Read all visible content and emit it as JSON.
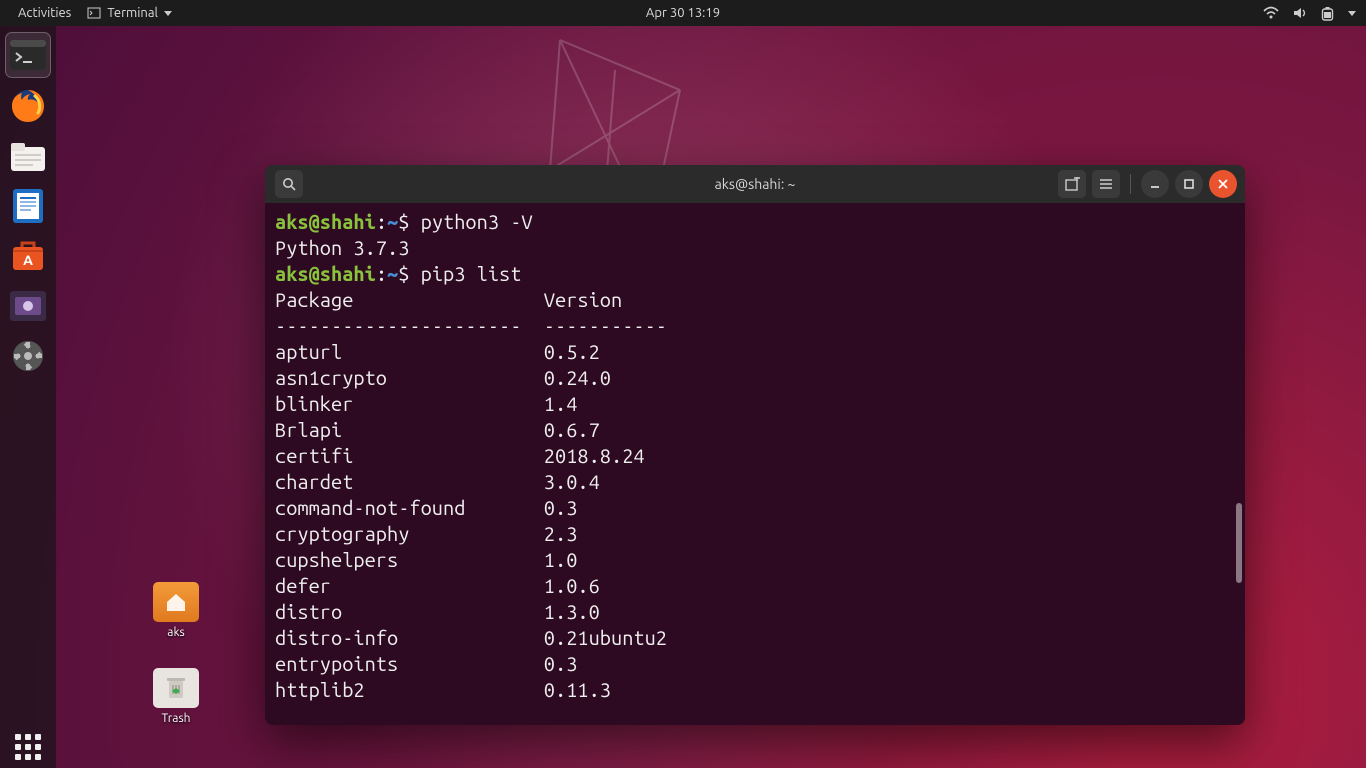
{
  "topbar": {
    "activities": "Activities",
    "app_menu": "Terminal",
    "clock": "Apr 30  13:19"
  },
  "dock": {
    "items": [
      {
        "name": "terminal-icon"
      },
      {
        "name": "firefox-icon"
      },
      {
        "name": "files-icon"
      },
      {
        "name": "writer-icon"
      },
      {
        "name": "software-icon"
      },
      {
        "name": "screenshot-icon"
      },
      {
        "name": "settings-icon"
      }
    ]
  },
  "desktop_icons": {
    "home": "aks",
    "trash": "Trash"
  },
  "terminal": {
    "title": "aks@shahi: ~",
    "prompt": {
      "userhost": "aks@shahi",
      "path": "~",
      "sep": ":",
      "dollar": "$"
    },
    "cmd1": "python3 -V",
    "out1": "Python 3.7.3",
    "cmd2": "pip3 list",
    "hdr_package": "Package",
    "hdr_version": "Version",
    "rule_package": "----------------------",
    "rule_version": "-----------",
    "packages": [
      {
        "n": "apturl",
        "v": "0.5.2"
      },
      {
        "n": "asn1crypto",
        "v": "0.24.0"
      },
      {
        "n": "blinker",
        "v": "1.4"
      },
      {
        "n": "Brlapi",
        "v": "0.6.7"
      },
      {
        "n": "certifi",
        "v": "2018.8.24"
      },
      {
        "n": "chardet",
        "v": "3.0.4"
      },
      {
        "n": "command-not-found",
        "v": "0.3"
      },
      {
        "n": "cryptography",
        "v": "2.3"
      },
      {
        "n": "cupshelpers",
        "v": "1.0"
      },
      {
        "n": "defer",
        "v": "1.0.6"
      },
      {
        "n": "distro",
        "v": "1.3.0"
      },
      {
        "n": "distro-info",
        "v": "0.21ubuntu2"
      },
      {
        "n": "entrypoints",
        "v": "0.3"
      },
      {
        "n": "httplib2",
        "v": "0.11.3"
      }
    ]
  },
  "colors": {
    "prompt_green": "#89c33b",
    "prompt_blue": "#4a8dd6",
    "close_orange": "#e9542f"
  }
}
